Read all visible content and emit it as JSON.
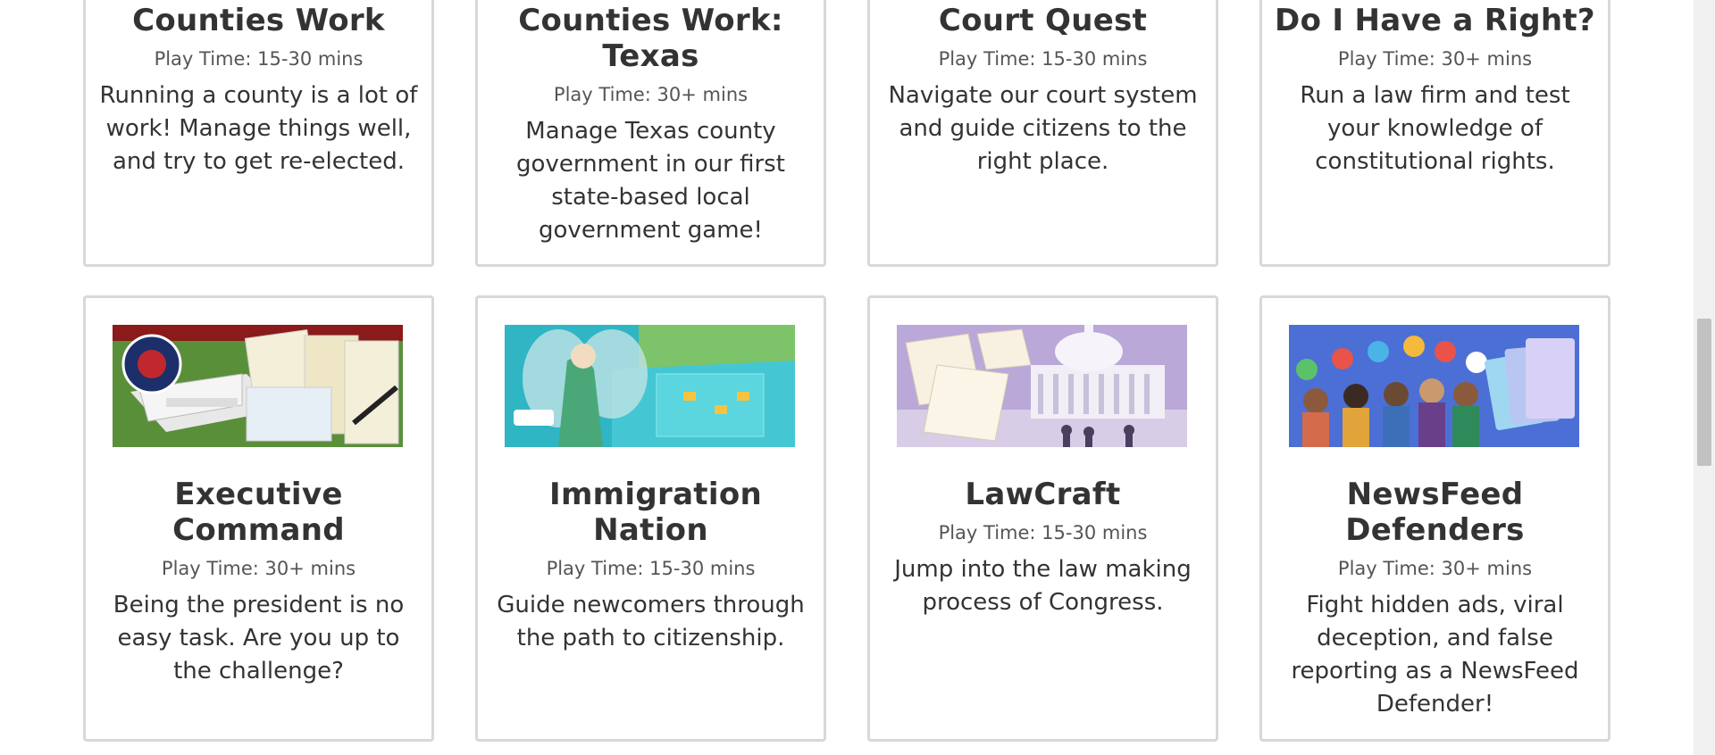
{
  "games_row1": [
    {
      "title": "Counties Work",
      "play_time": "Play Time: 15-30 mins",
      "description": "Running a county is a lot of work! Manage things well, and try to get re-elected."
    },
    {
      "title": "Counties Work: Texas",
      "play_time": "Play Time: 30+ mins",
      "description": "Manage Texas county government in our first state-based local government game!"
    },
    {
      "title": "Court Quest",
      "play_time": "Play Time: 15-30 mins",
      "description": "Navigate our court system and guide citizens to the right place."
    },
    {
      "title": "Do I Have a Right?",
      "play_time": "Play Time: 30+ mins",
      "description": "Run a law firm and test your knowledge of constitutional rights."
    }
  ],
  "games_row2": [
    {
      "title": "Executive Command",
      "play_time": "Play Time: 30+ mins",
      "description": "Being the president is no easy task. Are you up to the challenge?",
      "image": "white-house-documents-art"
    },
    {
      "title": "Immigration Nation",
      "play_time": "Play Time: 15-30 mins",
      "description": "Guide newcomers through the path to citizenship.",
      "image": "liberty-fairy-harbor-art"
    },
    {
      "title": "LawCraft",
      "play_time": "Play Time: 15-30 mins",
      "description": "Jump into the law making process of Congress.",
      "image": "capitol-papers-art"
    },
    {
      "title": "NewsFeed Defenders",
      "play_time": "Play Time: 30+ mins",
      "description": "Fight hidden ads, viral deception, and false reporting as a NewsFeed Defender!",
      "image": "diverse-team-cards-art"
    }
  ],
  "colors": {
    "card_border": "#d8d8d8",
    "title": "#333333",
    "meta": "#555555"
  }
}
